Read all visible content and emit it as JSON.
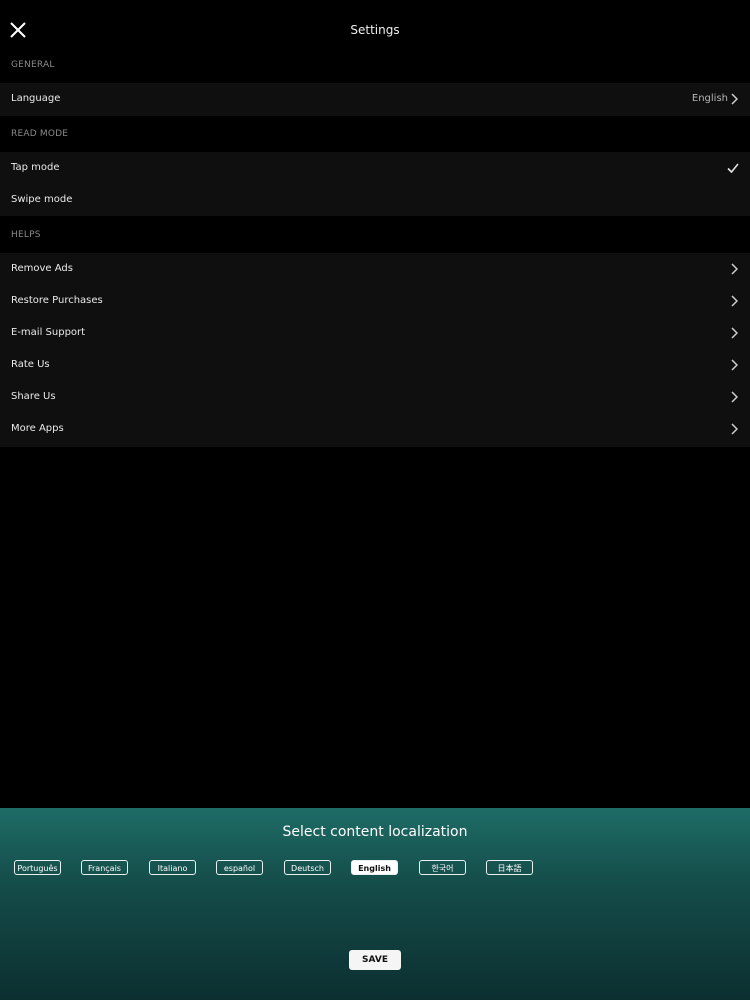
{
  "header": {
    "title": "Settings",
    "close_icon": "close-icon"
  },
  "sections": {
    "general": {
      "header": "GENERAL",
      "language_label": "Language",
      "language_value": "English"
    },
    "read_mode": {
      "header": "READ MODE",
      "tap_label": "Tap mode",
      "swipe_label": "Swipe mode",
      "selected": "Tap mode"
    },
    "helps": {
      "header": "HELPS",
      "items": [
        {
          "label": "Remove Ads"
        },
        {
          "label": "Restore Purchases"
        },
        {
          "label": "E-mail Support"
        },
        {
          "label": "Rate Us"
        },
        {
          "label": "Share Us"
        },
        {
          "label": "More Apps"
        }
      ]
    }
  },
  "localization": {
    "title": "Select content localization",
    "languages": [
      "Português",
      "Français",
      "Italiano",
      "español",
      "Deutsch",
      "English",
      "한국어",
      "日本語"
    ],
    "selected": "English",
    "save_label": "SAVE"
  },
  "colors": {
    "background": "#000000",
    "row_background": "#0f0f10",
    "panel_top": "#1e6c66",
    "panel_bottom": "#0c2f30"
  }
}
